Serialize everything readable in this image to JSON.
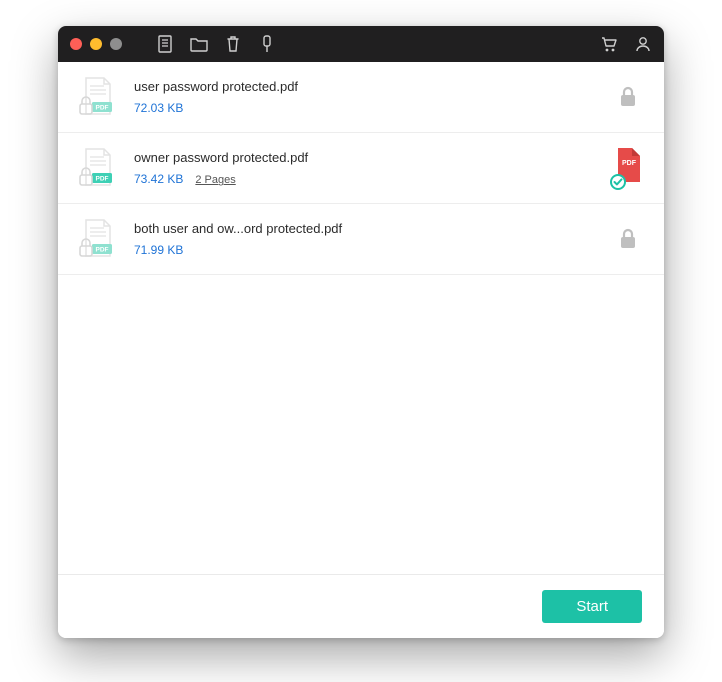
{
  "colors": {
    "accent": "#1dc1a6",
    "link": "#1f73d6",
    "pdfRed": "#e64b49"
  },
  "titlebar": {
    "icons_left": [
      "document-icon",
      "folder-icon",
      "trash-icon",
      "tag-icon"
    ],
    "icons_right": [
      "cart-icon",
      "user-icon"
    ]
  },
  "files": [
    {
      "name": "user password protected.pdf",
      "size": "72.03 KB",
      "pages": "",
      "status": "locked"
    },
    {
      "name": "owner password protected.pdf",
      "size": "73.42 KB",
      "pages": "2 Pages",
      "status": "pdf-ok"
    },
    {
      "name": "both user and ow...ord protected.pdf",
      "size": "71.99 KB",
      "pages": "",
      "status": "locked"
    }
  ],
  "footer": {
    "start_label": "Start"
  }
}
